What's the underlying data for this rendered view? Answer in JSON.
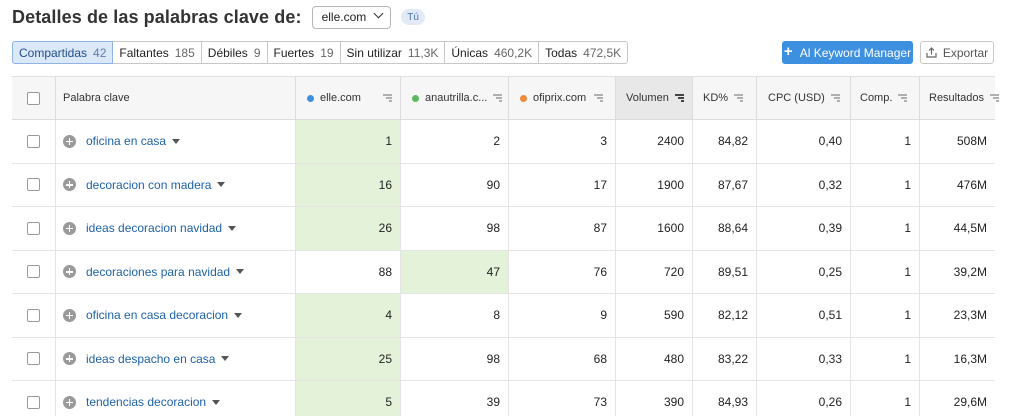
{
  "header": {
    "title": "Detalles de las palabras clave de:",
    "selected_domain": "elle.com",
    "badge": "Tú"
  },
  "tabs": [
    {
      "label": "Compartidas",
      "count": "42",
      "active": true
    },
    {
      "label": "Faltantes",
      "count": "185",
      "active": false
    },
    {
      "label": "Débiles",
      "count": "9",
      "active": false
    },
    {
      "label": "Fuertes",
      "count": "19",
      "active": false
    },
    {
      "label": "Sin utilizar",
      "count": "11,3K",
      "active": false
    },
    {
      "label": "Únicas",
      "count": "460,2K",
      "active": false
    },
    {
      "label": "Todas",
      "count": "472,5K",
      "active": false
    }
  ],
  "actions": {
    "keyword_manager_label": "Al Keyword Manager",
    "export_label": "Exportar"
  },
  "colors": {
    "accent": "#3d8fe0",
    "domain1": "#3d8fe0",
    "domain2": "#5cb85c",
    "domain3": "#f0893c",
    "highlight": "#e3f2d9"
  },
  "table": {
    "columns": {
      "keyword": "Palabra clave",
      "domain1": "elle.com",
      "domain2": "anautrilla.c...",
      "domain3": "ofiprix.com",
      "volume": "Volumen",
      "kd": "KD%",
      "cpc": "CPC (USD)",
      "comp": "Comp.",
      "results": "Resultados"
    },
    "rows": [
      {
        "keyword": "oficina en casa",
        "d1": "1",
        "d2": "2",
        "d3": "3",
        "volume": "2400",
        "kd": "84,82",
        "cpc": "0,40",
        "comp": "1",
        "results": "508M",
        "best": "d1"
      },
      {
        "keyword": "decoracion con madera",
        "d1": "16",
        "d2": "90",
        "d3": "17",
        "volume": "1900",
        "kd": "87,67",
        "cpc": "0,32",
        "comp": "1",
        "results": "476M",
        "best": "d1"
      },
      {
        "keyword": "ideas decoracion navidad",
        "d1": "26",
        "d2": "98",
        "d3": "87",
        "volume": "1600",
        "kd": "88,64",
        "cpc": "0,39",
        "comp": "1",
        "results": "44,5M",
        "best": "d1"
      },
      {
        "keyword": "decoraciones para navidad",
        "d1": "88",
        "d2": "47",
        "d3": "76",
        "volume": "720",
        "kd": "89,51",
        "cpc": "0,25",
        "comp": "1",
        "results": "39,2M",
        "best": "d2"
      },
      {
        "keyword": "oficina en casa decoracion",
        "d1": "4",
        "d2": "8",
        "d3": "9",
        "volume": "590",
        "kd": "82,12",
        "cpc": "0,51",
        "comp": "1",
        "results": "23,3M",
        "best": "d1"
      },
      {
        "keyword": "ideas despacho en casa",
        "d1": "25",
        "d2": "98",
        "d3": "68",
        "volume": "480",
        "kd": "83,22",
        "cpc": "0,33",
        "comp": "1",
        "results": "16,3M",
        "best": "d1"
      },
      {
        "keyword": "tendencias decoracion",
        "d1": "5",
        "d2": "39",
        "d3": "73",
        "volume": "390",
        "kd": "84,93",
        "cpc": "0,26",
        "comp": "1",
        "results": "29,6M",
        "best": "d1"
      }
    ]
  }
}
